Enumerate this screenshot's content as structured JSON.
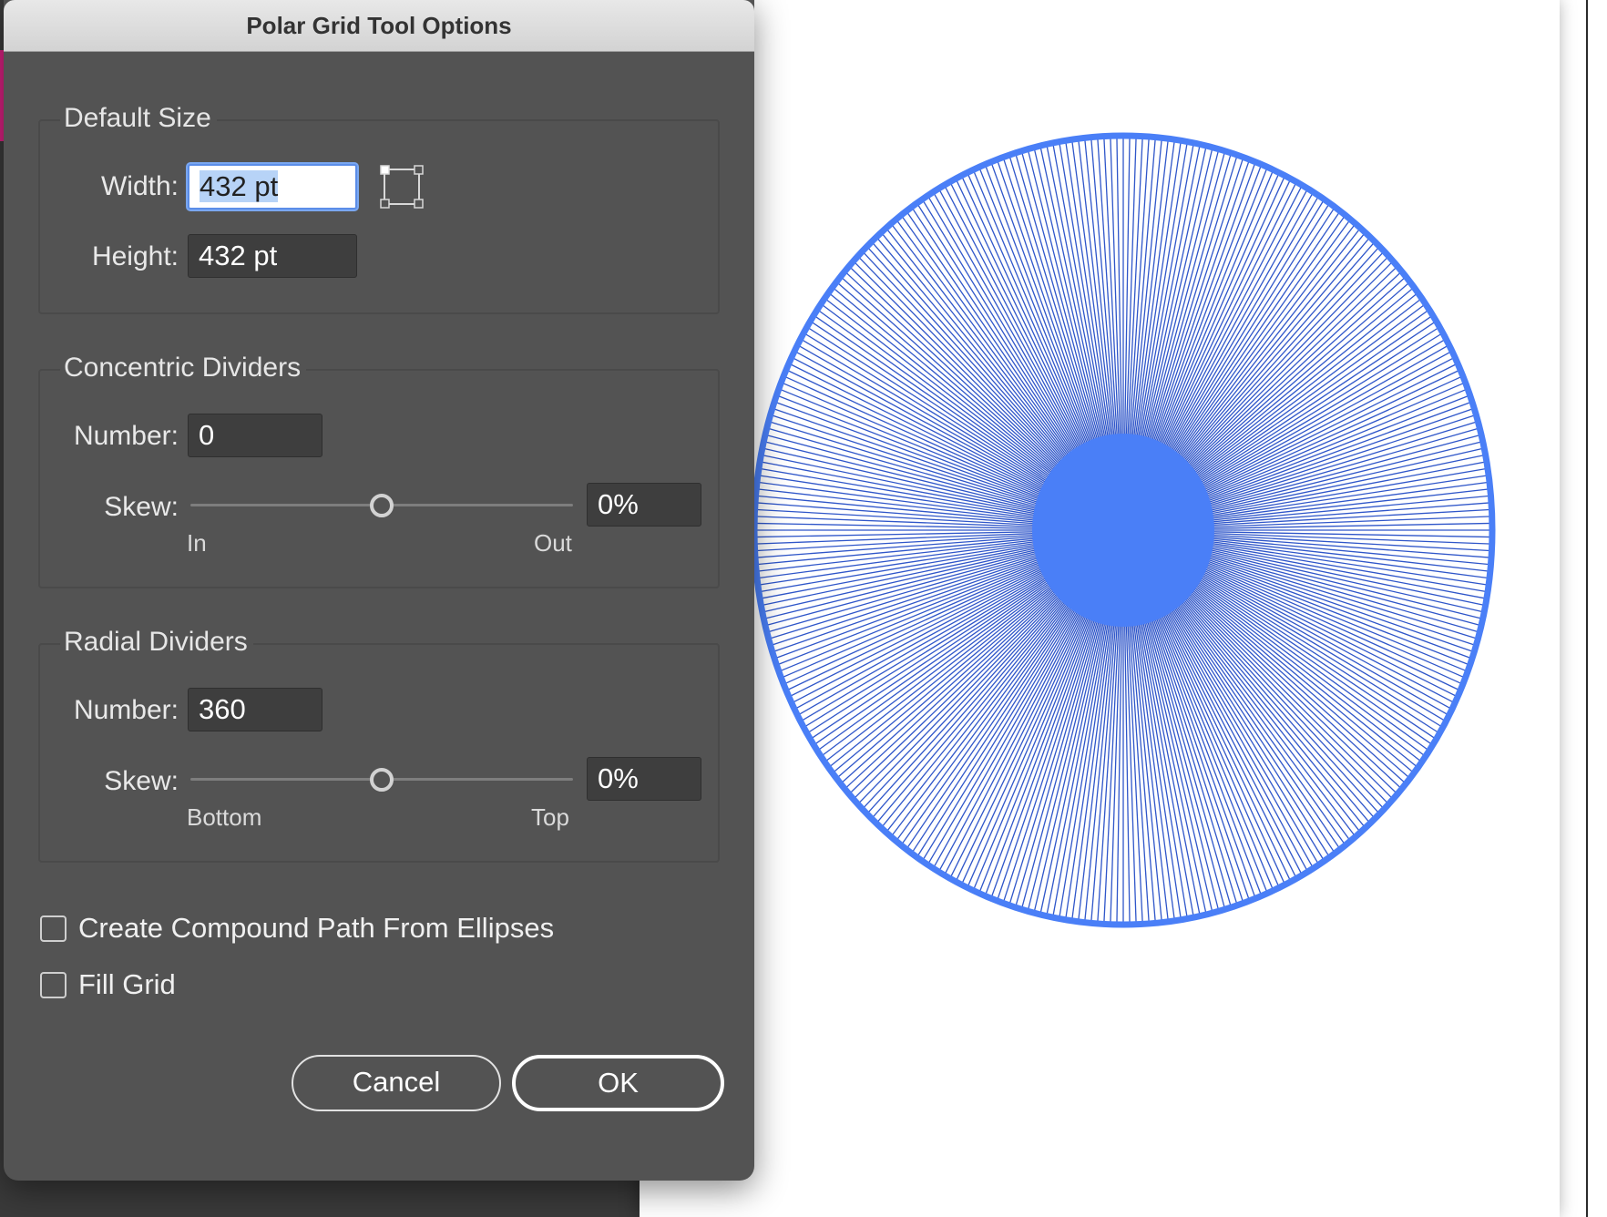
{
  "dialog": {
    "title": "Polar Grid Tool Options",
    "default_size": {
      "title": "Default Size",
      "width_label": "Width:",
      "width_value": "432 pt",
      "height_label": "Height:",
      "height_value": "432 pt",
      "icon": "reference-point-icon"
    },
    "concentric": {
      "title": "Concentric Dividers",
      "number_label": "Number:",
      "number_value": "0",
      "skew_label": "Skew:",
      "skew_value": "0%",
      "skew_level": 0.5,
      "min_label": "In",
      "max_label": "Out"
    },
    "radial": {
      "title": "Radial Dividers",
      "number_label": "Number:",
      "number_value": "360",
      "skew_label": "Skew:",
      "skew_value": "0%",
      "skew_level": 0.5,
      "min_label": "Bottom",
      "max_label": "Top"
    },
    "options": {
      "compound_label": "Create Compound Path From Ellipses",
      "compound_checked": false,
      "fill_label": "Fill Grid",
      "fill_checked": false
    },
    "buttons": {
      "cancel": "Cancel",
      "ok": "OK"
    }
  },
  "canvas": {
    "grid_color": "#4a7ff7",
    "radial_dividers": 360
  }
}
